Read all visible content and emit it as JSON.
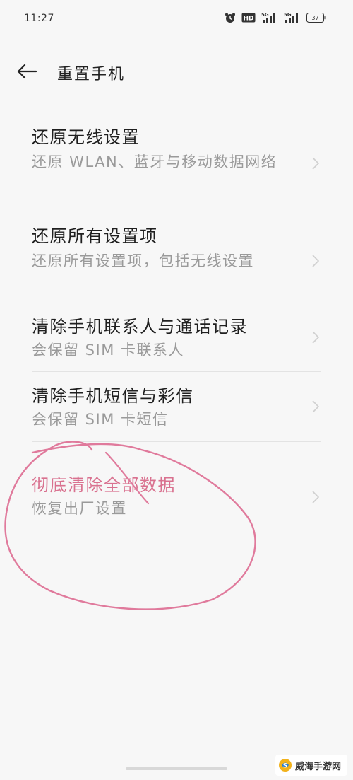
{
  "status_bar": {
    "time": "11:27",
    "hd_label": "HD",
    "network_1": "5G",
    "network_2": "5G",
    "battery_label": "37"
  },
  "header": {
    "title": "重置手机"
  },
  "items": [
    {
      "title": "还原无线设置",
      "subtitle": "还原 WLAN、蓝牙与移动数据网络"
    },
    {
      "title": "还原所有设置项",
      "subtitle": "还原所有设置项，包括无线设置"
    },
    {
      "title": "清除手机联系人与通话记录",
      "subtitle": "会保留 SIM 卡联系人"
    },
    {
      "title": "清除手机短信与彩信",
      "subtitle": "会保留 SIM 卡短信"
    },
    {
      "title": "彻底清除全部数据",
      "subtitle": "恢复出厂设置"
    }
  ],
  "watermark": {
    "text": "威海手游网"
  },
  "colors": {
    "accent_pink": "#d9718f",
    "annotation_pink": "#e07a9c",
    "text_primary": "#1f1f1f",
    "text_secondary": "#9a9a9a",
    "background": "#f7f7f7"
  }
}
